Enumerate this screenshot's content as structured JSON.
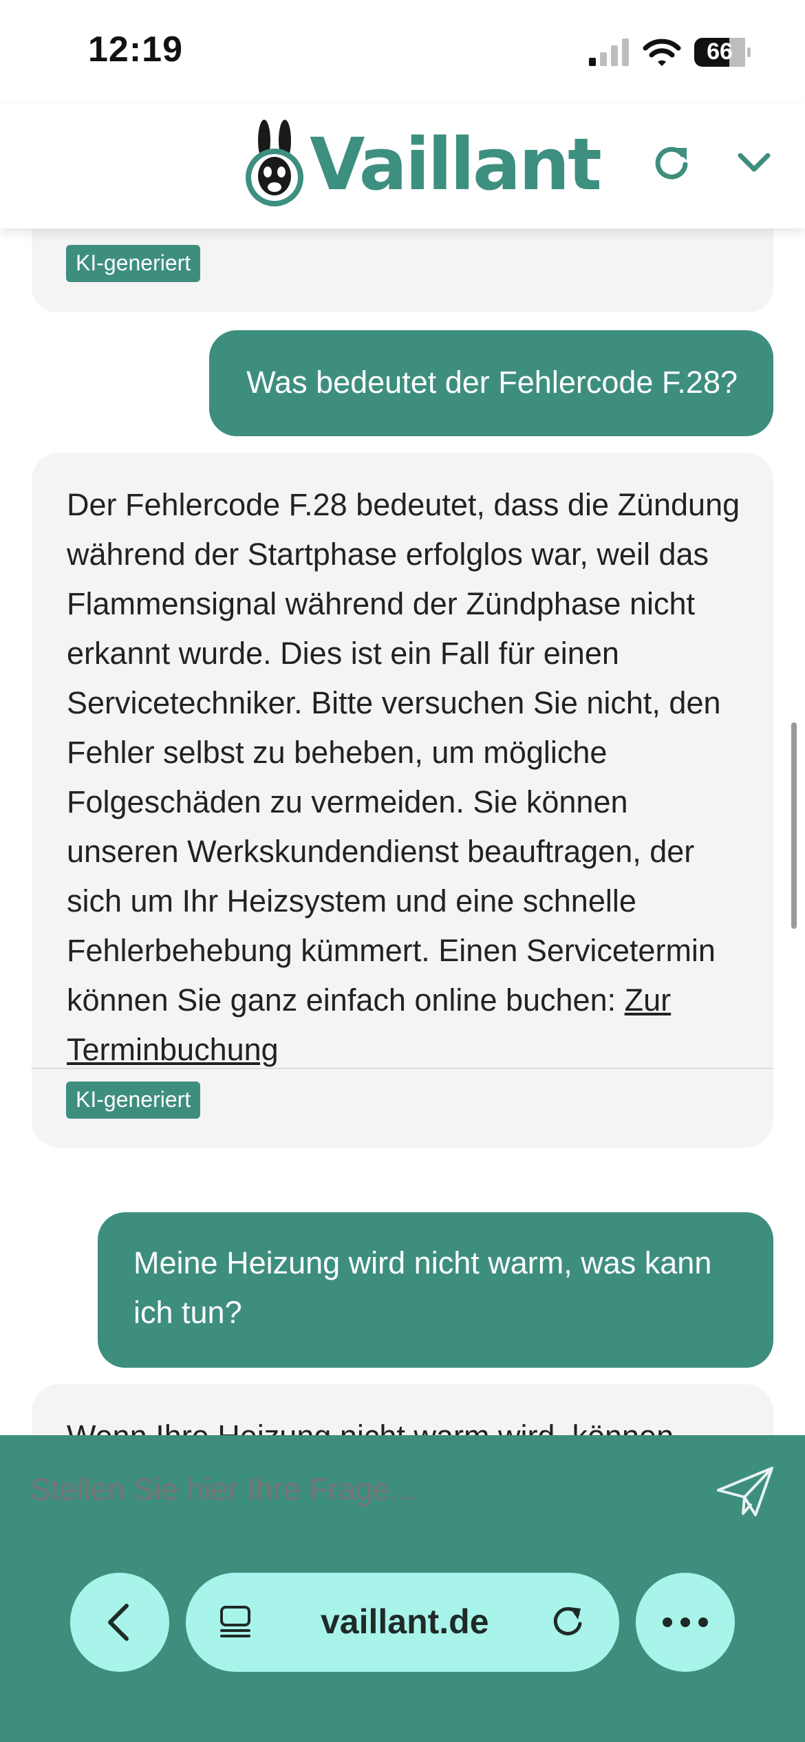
{
  "status_bar": {
    "time": "12:19",
    "battery": "66"
  },
  "header": {
    "brand": "Vaillant"
  },
  "chat": {
    "messages": [
      {
        "role": "bot",
        "badge": "KI-generiert"
      },
      {
        "role": "user",
        "text": "Was bedeutet der Fehlercode F.28?"
      },
      {
        "role": "bot",
        "text": "Der Fehlercode F.28 bedeutet, dass die Zündung während der Startphase erfolglos war, weil das Flammensignal während der Zündphase nicht erkannt wurde. Dies ist ein Fall für einen Servicetechniker. Bitte versuchen Sie nicht, den Fehler selbst zu beheben, um mögliche Folgeschäden zu vermeiden. Sie können unseren Werkskundendienst beauftragen, der sich um Ihr Heizsystem und eine schnelle Fehlerbehebung kümmert. Einen Servicetermin können Sie ganz einfach online buchen:",
        "link": "Zur Terminbuchung",
        "badge": "KI-generiert"
      },
      {
        "role": "user",
        "text": "Meine Heizung wird nicht warm, was kann ich tun?"
      },
      {
        "role": "bot",
        "text": "Wenn Ihre Heizung nicht warm wird, können"
      }
    ]
  },
  "input": {
    "placeholder": "Stellen Sie hier Ihre Frage..."
  },
  "browser": {
    "url": "vaillant.de"
  },
  "colors": {
    "brand_green": "#3e8e7e",
    "pill": "#a8f4ea",
    "bubble_gray": "#f4f4f4"
  }
}
